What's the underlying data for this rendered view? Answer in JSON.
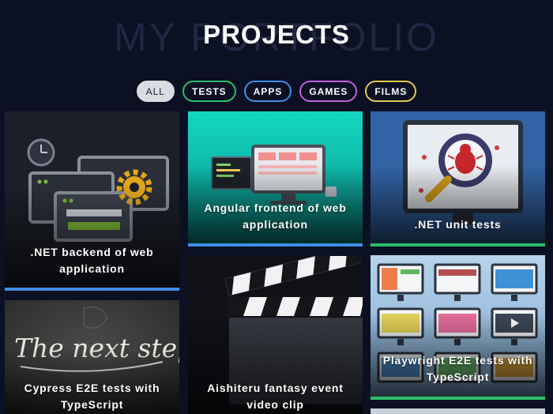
{
  "header": {
    "background_title": "MY PORTFOLIO",
    "title": "PROJECTS"
  },
  "filters": [
    {
      "label": "ALL",
      "active": true
    },
    {
      "label": "TESTS",
      "color": "#2bbf6a"
    },
    {
      "label": "APPS",
      "color": "#3d8ee6"
    },
    {
      "label": "GAMES",
      "color": "#c25ed8"
    },
    {
      "label": "FILMS",
      "color": "#e0c94c"
    }
  ],
  "projects": [
    {
      "title": ".NET backend of web application",
      "category": "APPS",
      "art": "server-windows-gear-clock"
    },
    {
      "title": "Angular frontend of web application",
      "category": "APPS",
      "art": "desktop-monitor-code"
    },
    {
      "title": ".NET unit tests",
      "category": "TESTS",
      "art": "monitor-magnifier-bug"
    },
    {
      "title": "Cypress E2E tests with TypeScript",
      "category": "TESTS",
      "art": "chalkboard-next-step"
    },
    {
      "title": "Aishiteru fantasy event video clip",
      "category": "FILMS",
      "art": "clapperboard"
    },
    {
      "title": "Playwright E2E tests with TypeScript",
      "category": "TESTS",
      "art": "monitor-grid"
    }
  ],
  "art_text": {
    "chalkboard": "The next step"
  },
  "colors": {
    "background": "#0b1023",
    "apps": "#3d8ee6",
    "tests": "#2bbf6a",
    "games": "#c25ed8",
    "films": "#e0c94c"
  }
}
